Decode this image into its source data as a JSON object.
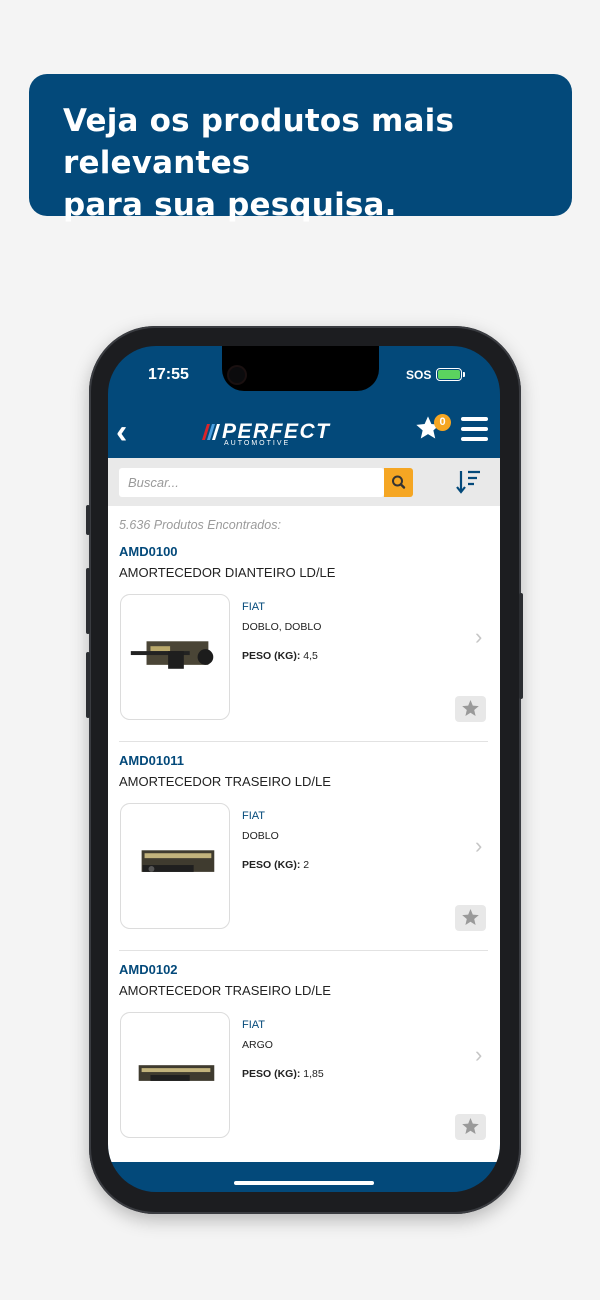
{
  "banner": {
    "text": "Veja os produtos mais relevantes\npara sua pesquisa."
  },
  "status_bar": {
    "time": "17:55",
    "carrier": "SOS"
  },
  "header": {
    "logo_text": "PERFECT",
    "logo_subtext": "AUTOMOTIVE",
    "favorites_count": "0"
  },
  "search": {
    "placeholder": "Buscar..."
  },
  "results": {
    "count_text": "5.636 Produtos Encontrados:"
  },
  "products": [
    {
      "code": "AMD0100",
      "name": "AMORTECEDOR DIANTEIRO LD/LE",
      "brand": "FIAT",
      "models": "DOBLO, DOBLO",
      "weight_label": "PESO (KG):",
      "weight_value": "4,5"
    },
    {
      "code": "AMD01011",
      "name": "AMORTECEDOR TRASEIRO LD/LE",
      "brand": "FIAT",
      "models": "DOBLO",
      "weight_label": "PESO (KG):",
      "weight_value": "2"
    },
    {
      "code": "AMD0102",
      "name": "AMORTECEDOR TRASEIRO LD/LE",
      "brand": "FIAT",
      "models": "ARGO",
      "weight_label": "PESO (KG):",
      "weight_value": "1,85"
    }
  ],
  "colors": {
    "primary": "#03497a",
    "accent": "#f5a623",
    "background": "#f4f4f4"
  }
}
